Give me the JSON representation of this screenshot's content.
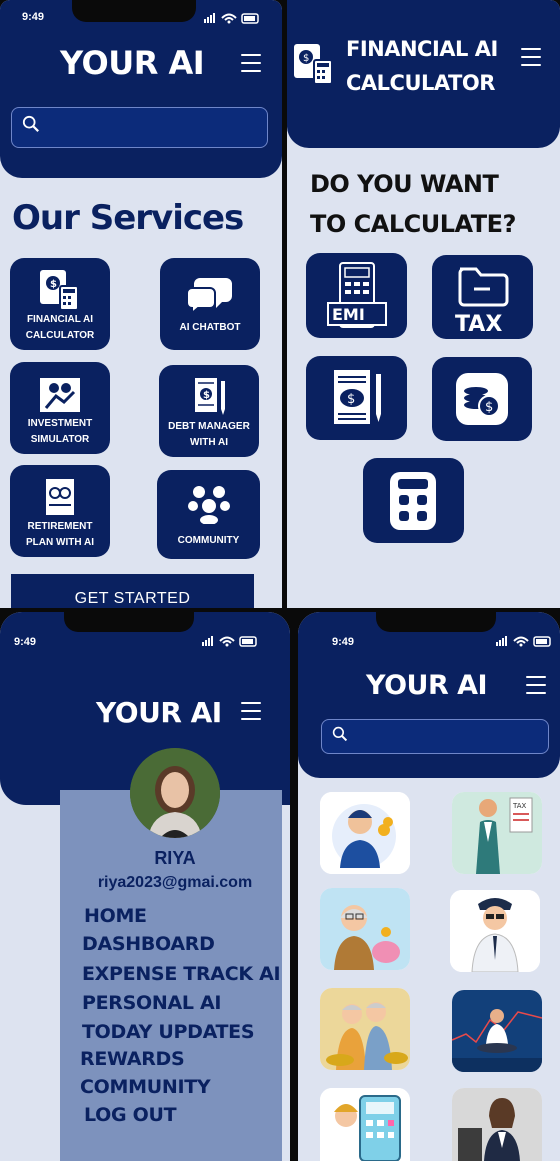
{
  "status": {
    "time": "9:49"
  },
  "brand": "YOUR AI",
  "services": {
    "title": "Our Services",
    "tiles": [
      {
        "label": "FINANCIAL AI CALCULATOR",
        "icon": "calculator-document-icon"
      },
      {
        "label": "AI CHATBOT",
        "icon": "chat-bubbles-icon"
      },
      {
        "label": "INVESTMENT SIMULATOR",
        "icon": "investment-icon"
      },
      {
        "label": "DEBT MANAGER WITH AI",
        "icon": "debt-document-icon"
      },
      {
        "label": "RETIREMENT PLAN WITH AI",
        "icon": "retirement-icon"
      },
      {
        "label": "COMMUNITY",
        "icon": "community-icon"
      }
    ],
    "cta": "GET STARTED"
  },
  "calculator": {
    "title_line1": "FINANCIAL AI",
    "title_line2": "CALCULATOR",
    "question_line1": "DO  YOU WANT",
    "question_line2": "TO CALCULATE?",
    "emi_label": "EMI",
    "tax_label": "TAX"
  },
  "profile": {
    "name": "RIYA",
    "email": "riya2023@gmai.com",
    "menu": [
      "HOME",
      "DASHBOARD",
      "EXPENSE TRACK AI",
      "PERSONAL AI",
      "TODAY  UPDATES",
      "REWARDS",
      "COMMUNITY",
      "LOG OUT"
    ]
  },
  "colors": {
    "primary": "#0a2160",
    "background": "#dde3f0",
    "drawer": "#7d92bd"
  }
}
